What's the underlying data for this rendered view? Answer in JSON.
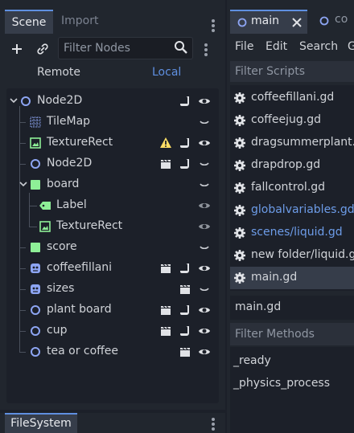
{
  "scene_dock": {
    "tabs": [
      "Scene",
      "Import"
    ],
    "filter_placeholder": "Filter Nodes",
    "remote_label": "Remote",
    "local_label": "Local",
    "tree": [
      {
        "name": "Node2D",
        "icon": "node2d-icon",
        "status": [
          "script-icon",
          "visibility-eye-icon"
        ]
      },
      {
        "name": "TileMap",
        "icon": "tilemap-icon",
        "status": [
          "visibility-closed-icon"
        ]
      },
      {
        "name": "TextureRect",
        "icon": "texturerect-icon",
        "status": [
          "warning-icon",
          "script-icon",
          "visibility-eye-icon"
        ]
      },
      {
        "name": "Node2D",
        "icon": "node2d-icon",
        "status": [
          "clapperboard-icon",
          "script-icon",
          "visibility-closed-icon"
        ]
      },
      {
        "name": "board",
        "icon": "control-icon",
        "status": [
          "visibility-closed-icon"
        ]
      },
      {
        "name": "Label",
        "icon": "label-icon",
        "status": [
          "visibility-eye-icon"
        ]
      },
      {
        "name": "TextureRect",
        "icon": "texturerect-icon",
        "status": [
          "visibility-eye-icon"
        ]
      },
      {
        "name": "score",
        "icon": "control-icon",
        "status": [
          "visibility-closed-icon"
        ]
      },
      {
        "name": "coffeefillani",
        "icon": "animatedsprite-icon",
        "status": [
          "clapperboard-icon",
          "script-icon",
          "visibility-eye-icon"
        ]
      },
      {
        "name": "sizes",
        "icon": "animatedsprite-icon",
        "status": [
          "clapperboard-icon",
          "visibility-closed-icon"
        ]
      },
      {
        "name": "plant board",
        "icon": "node2d-icon",
        "status": [
          "clapperboard-icon",
          "script-icon",
          "visibility-eye-icon"
        ]
      },
      {
        "name": "cup",
        "icon": "node2d-icon",
        "status": [
          "clapperboard-icon",
          "script-icon",
          "visibility-eye-icon"
        ]
      },
      {
        "name": "tea or coffee",
        "icon": "node2d-icon",
        "status": [
          "clapperboard-icon",
          "visibility-eye-icon"
        ]
      }
    ],
    "filesystem_tab": "FileSystem"
  },
  "script_panel": {
    "tabs": [
      "main",
      "co"
    ],
    "menus": [
      "File",
      "Edit",
      "Search",
      "G"
    ],
    "filter_scripts_placeholder": "Filter Scripts",
    "scripts": [
      {
        "name": "coffeefillani.gd",
        "color": "#d0d3d8"
      },
      {
        "name": "coffeejug.gd",
        "color": "#d0d3d8"
      },
      {
        "name": "dragsummerplant.gd",
        "color": "#d0d3d8"
      },
      {
        "name": "drapdrop.gd",
        "color": "#d0d3d8"
      },
      {
        "name": "fallcontrol.gd",
        "color": "#d0d3d8"
      },
      {
        "name": "globalvariables.gd",
        "color": "#6d9ce8"
      },
      {
        "name": "scenes/liquid.gd",
        "color": "#6d9ce8"
      },
      {
        "name": "new folder/liquid.gd",
        "color": "#d0d3d8"
      },
      {
        "name": "main.gd",
        "color": "#d0d3d8"
      }
    ],
    "current_script": "main.gd",
    "filter_methods_placeholder": "Filter Methods",
    "methods": [
      "_ready",
      "_physics_process"
    ]
  },
  "colors": {
    "accent": "#5f8fe0",
    "icon_green": "#8eef97",
    "icon_blue": "#8da5f3",
    "warning": "#ffdd65",
    "panel": "#21262e",
    "field": "#1c2029"
  }
}
